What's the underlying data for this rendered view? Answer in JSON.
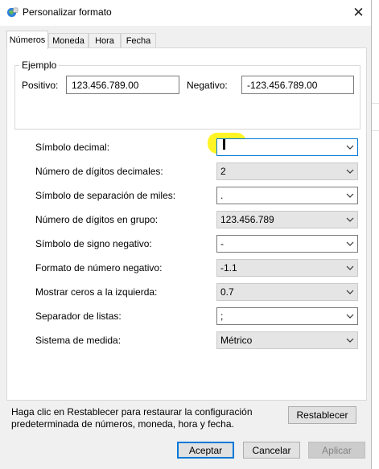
{
  "window": {
    "title": "Personalizar formato",
    "close_glyph": "✕"
  },
  "tabs": [
    {
      "label": "Números",
      "active": true
    },
    {
      "label": "Moneda",
      "active": false
    },
    {
      "label": "Hora",
      "active": false
    },
    {
      "label": "Fecha",
      "active": false
    }
  ],
  "example": {
    "legend": "Ejemplo",
    "positive_label": "Positivo:",
    "positive_value": "123.456.789.00",
    "negative_label": "Negativo:",
    "negative_value": "-123.456.789.00"
  },
  "settings": [
    {
      "label": "Símbolo decimal:",
      "value": "",
      "type": "edit"
    },
    {
      "label": "Número de dígitos decimales:",
      "value": "2",
      "type": "list"
    },
    {
      "label": "Símbolo de separación de miles:",
      "value": ".",
      "type": "edit"
    },
    {
      "label": "Número de dígitos en grupo:",
      "value": "123.456.789",
      "type": "list"
    },
    {
      "label": "Símbolo de signo negativo:",
      "value": "-",
      "type": "edit"
    },
    {
      "label": "Formato de número negativo:",
      "value": "-1.1",
      "type": "list"
    },
    {
      "label": "Mostrar ceros a la izquierda:",
      "value": "0.7",
      "type": "list"
    },
    {
      "label": "Separador de listas:",
      "value": ";",
      "type": "edit"
    },
    {
      "label": "Sistema de medida:",
      "value": "Métrico",
      "type": "list"
    }
  ],
  "reset": {
    "text_line1": "Haga clic en Restablecer para restaurar la configuración",
    "text_line2": "predeterminada de números, moneda, hora y fecha.",
    "button": "Restablecer"
  },
  "buttons": {
    "ok": "Aceptar",
    "cancel": "Cancelar",
    "apply": "Aplicar"
  },
  "colors": {
    "focus_border": "#0078d7",
    "highlight": "#fff200",
    "dialog_bg": "#f0f0f0"
  }
}
